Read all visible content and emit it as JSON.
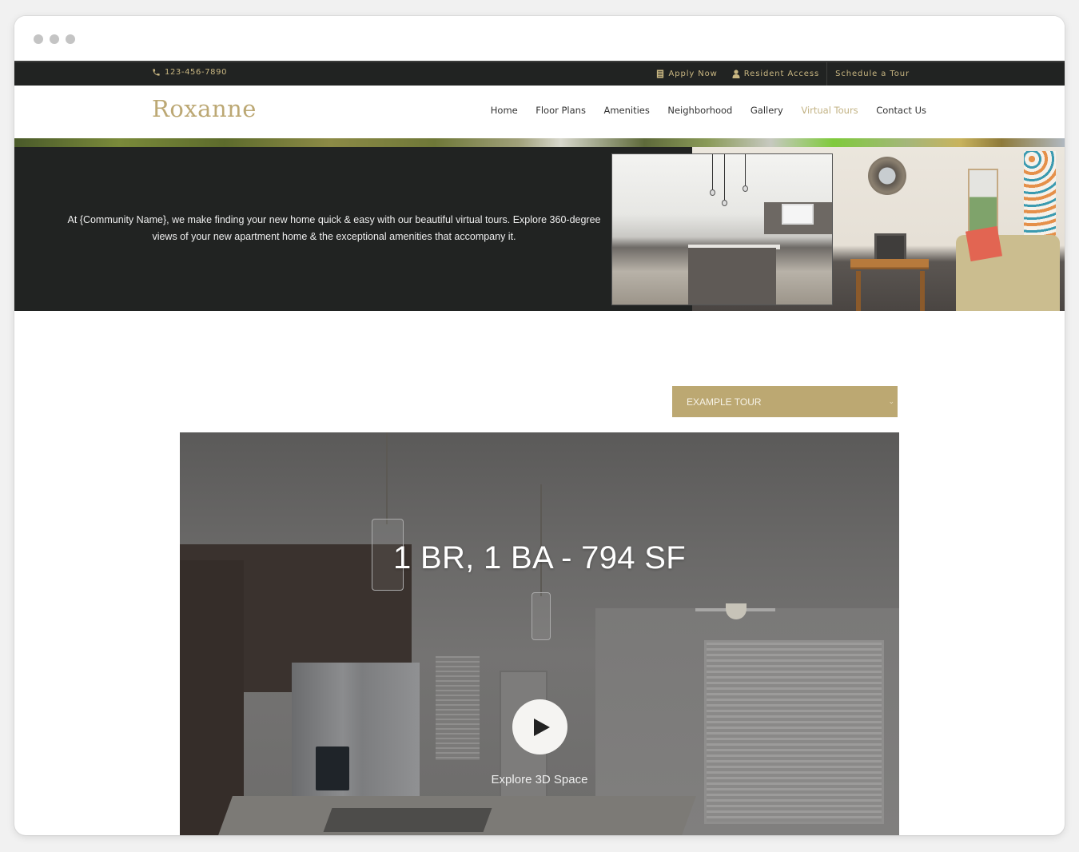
{
  "browser": {
    "window_controls": [
      "dot",
      "dot",
      "dot"
    ]
  },
  "topbar": {
    "phone": {
      "icon": "phone-icon",
      "number": "123-456-7890"
    },
    "links": [
      {
        "icon": "document-icon",
        "label": "Apply Now"
      },
      {
        "icon": "person-icon",
        "label": "Resident Access"
      },
      {
        "icon": null,
        "label": "Schedule a Tour"
      }
    ]
  },
  "header": {
    "logo": "Roxanne",
    "nav": [
      {
        "label": "Home",
        "active": false
      },
      {
        "label": "Floor Plans",
        "active": false
      },
      {
        "label": "Amenities",
        "active": false
      },
      {
        "label": "Neighborhood",
        "active": false
      },
      {
        "label": "Gallery",
        "active": false
      },
      {
        "label": "Virtual Tours",
        "active": true
      },
      {
        "label": "Contact Us",
        "active": false
      }
    ]
  },
  "hero": {
    "text": "At {Community Name}, we make finding your new home quick & easy with our beautiful virtual tours. Explore 360-degree views of your new apartment home & the exceptional amenities that accompany it.",
    "images": [
      "kitchen-photo",
      "living-room-photo"
    ]
  },
  "tour_selector": {
    "selected": "EXAMPLE TOUR",
    "icon": "chevron-down-icon"
  },
  "tour_viewer": {
    "title": "1 BR, 1 BA - 794 SF",
    "action_label": "Explore 3D Space",
    "play_icon": "play-icon"
  },
  "colors": {
    "accent_gold": "#bca872",
    "topbar_bg": "#212322",
    "nav_active": "#c2b283",
    "text_dark": "#333333"
  }
}
